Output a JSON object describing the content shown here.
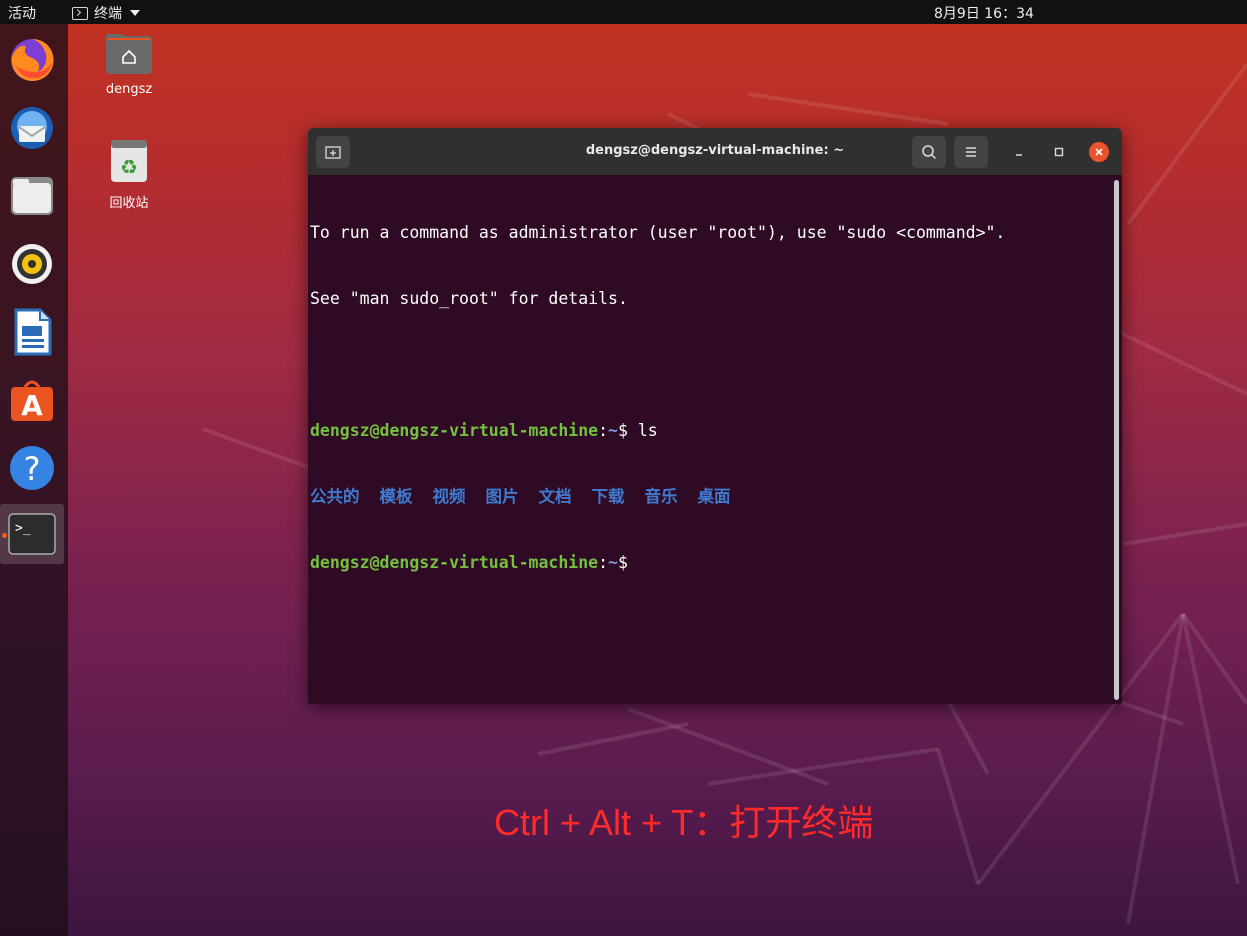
{
  "topbar": {
    "activities": "活动",
    "app_name": "终端",
    "clock": "8月9日 16：34"
  },
  "dock": {
    "items": [
      {
        "name": "firefox",
        "icon": "firefox-icon"
      },
      {
        "name": "thunderbird",
        "icon": "thunderbird-icon"
      },
      {
        "name": "files",
        "icon": "files-icon"
      },
      {
        "name": "rhythmbox",
        "icon": "rhythmbox-icon"
      },
      {
        "name": "libreoffice-writer",
        "icon": "writer-icon"
      },
      {
        "name": "ubuntu-software",
        "icon": "software-icon"
      },
      {
        "name": "help",
        "icon": "help-icon"
      },
      {
        "name": "terminal",
        "icon": "terminal-icon",
        "active": true
      }
    ]
  },
  "desktop": {
    "home_label": "dengsz",
    "trash_label": "回收站"
  },
  "terminal": {
    "title": "dengsz@dengsz-virtual-machine: ~",
    "lines": [
      "To run a command as administrator (user \"root\"), use \"sudo <command>\".",
      "See \"man sudo_root\" for details."
    ],
    "prompt_user": "dengsz@dengsz-virtual-machine",
    "prompt_sep": ":",
    "prompt_path": "~",
    "prompt_dollar": "$ ",
    "command": "ls",
    "dirs": [
      "公共的",
      "模板",
      "视频",
      "图片",
      "文档",
      "下载",
      "音乐",
      "桌面"
    ]
  },
  "caption": "Ctrl + Alt + T：打开终端",
  "colors": {
    "accent_orange": "#e9542d",
    "prompt_green": "#73c13f",
    "dir_blue": "#3e7bd0",
    "terminal_bg": "#2f0a24"
  }
}
